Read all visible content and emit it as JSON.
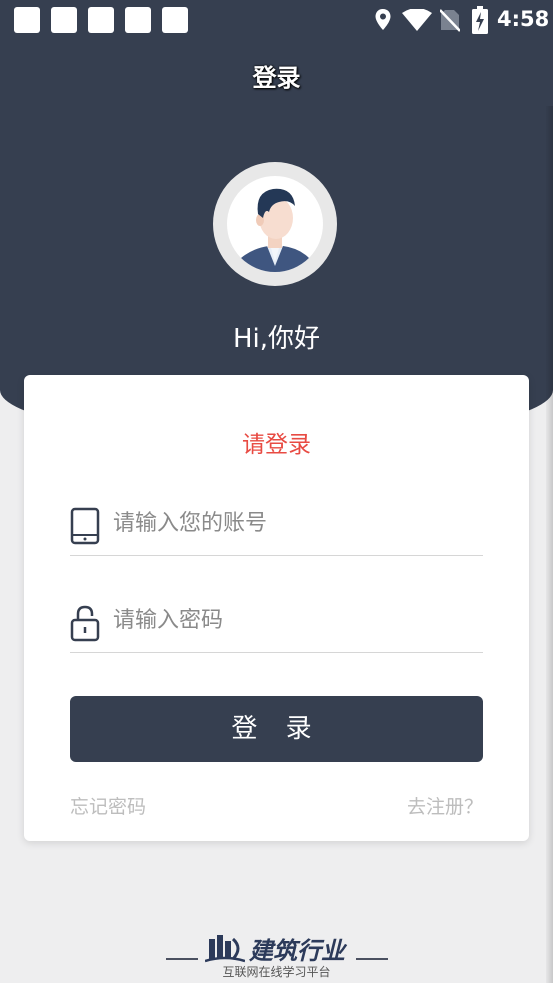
{
  "status_bar": {
    "time": "4:58",
    "icons": [
      "location-icon",
      "wifi-icon",
      "no-sim-icon",
      "battery-charging-icon"
    ],
    "notification_count": 5
  },
  "header": {
    "title": "登录",
    "greeting": "Hi,你好"
  },
  "form": {
    "heading": "请登录",
    "account": {
      "placeholder": "请输入您的账号",
      "value": "",
      "icon": "phone-icon"
    },
    "password": {
      "placeholder": "请输入密码",
      "value": "",
      "icon": "lock-icon"
    },
    "login_label": "登 录",
    "forgot_label": "忘记密码",
    "register_label": "去注册？"
  },
  "footer": {
    "logo_text": "建筑行业",
    "tagline": "互联网在线学习平台"
  },
  "colors": {
    "primary": "#363f50",
    "accent_red": "#e84b43",
    "background": "#eeeeef",
    "link_gray": "#bdbdbd"
  }
}
